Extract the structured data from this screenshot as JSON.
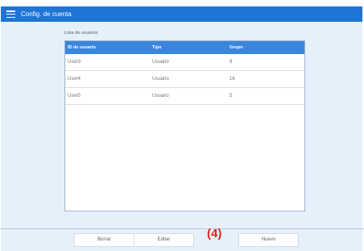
{
  "window": {
    "title": "Config. de cuenta",
    "menu_icon": "hamburger-menu-icon",
    "titlebar_color": "#1f74d6"
  },
  "users": {
    "list_title": "Lista de usuarios",
    "columns": [
      "ID de usuario",
      "Tipo",
      "Grupo"
    ],
    "rows": [
      {
        "id": "User3",
        "type": "Usuario",
        "group": "9"
      },
      {
        "id": "User4",
        "type": "Usuario",
        "group": "16"
      },
      {
        "id": "User5",
        "type": "Usuario",
        "group": "5"
      }
    ],
    "header_color": "#3a86dd"
  },
  "footer": {
    "delete_label": "Borrar",
    "edit_label": "Editar",
    "new_label": "Nuevo",
    "callout": "(4)",
    "callout_color": "#e2231a"
  }
}
